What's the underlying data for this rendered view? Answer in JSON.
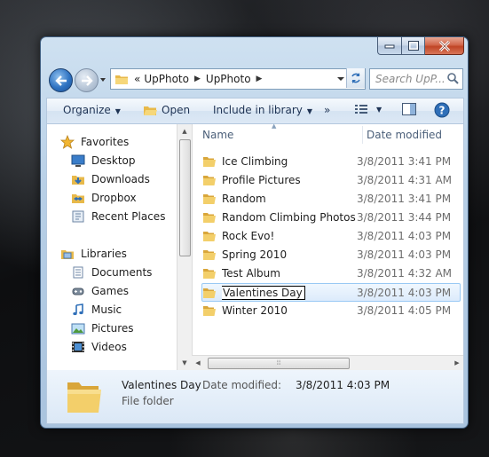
{
  "window": {
    "title": ""
  },
  "nav": {
    "address": {
      "prefix": "«",
      "segments": [
        "UpPhoto",
        "UpPhoto"
      ]
    },
    "search_placeholder": "Search UpP..."
  },
  "toolbar": {
    "organize": "Organize",
    "open": "Open",
    "include": "Include in library",
    "more": "»"
  },
  "sidebar": {
    "favorites_header": "Favorites",
    "favorites": [
      "Desktop",
      "Downloads",
      "Dropbox",
      "Recent Places"
    ],
    "libraries_header": "Libraries",
    "libraries": [
      "Documents",
      "Games",
      "Music",
      "Pictures",
      "Videos"
    ]
  },
  "columns": {
    "name": "Name",
    "date": "Date modified"
  },
  "files": [
    {
      "name": "Ice Climbing",
      "date": "3/8/2011 3:41 PM"
    },
    {
      "name": "Profile Pictures",
      "date": "3/8/2011 4:31 AM"
    },
    {
      "name": "Random",
      "date": "3/8/2011 3:41 PM"
    },
    {
      "name": "Random Climbing Photos",
      "date": "3/8/2011 3:44 PM"
    },
    {
      "name": "Rock Evo!",
      "date": "3/8/2011 4:03 PM"
    },
    {
      "name": "Spring 2010",
      "date": "3/8/2011 4:03 PM"
    },
    {
      "name": "Test Album",
      "date": "3/8/2011 4:32 AM"
    },
    {
      "name": "Valentines Day",
      "date": "3/8/2011 4:03 PM"
    },
    {
      "name": "Winter 2010",
      "date": "3/8/2011 4:05 PM"
    }
  ],
  "details": {
    "name": "Valentines Day",
    "modified_label": "Date modified:",
    "modified_value": "3/8/2011 4:03 PM",
    "type": "File folder"
  },
  "colors": {
    "accent": "#2f73c2",
    "selection": "#dcebfc",
    "folder": "#f3cf6a"
  }
}
